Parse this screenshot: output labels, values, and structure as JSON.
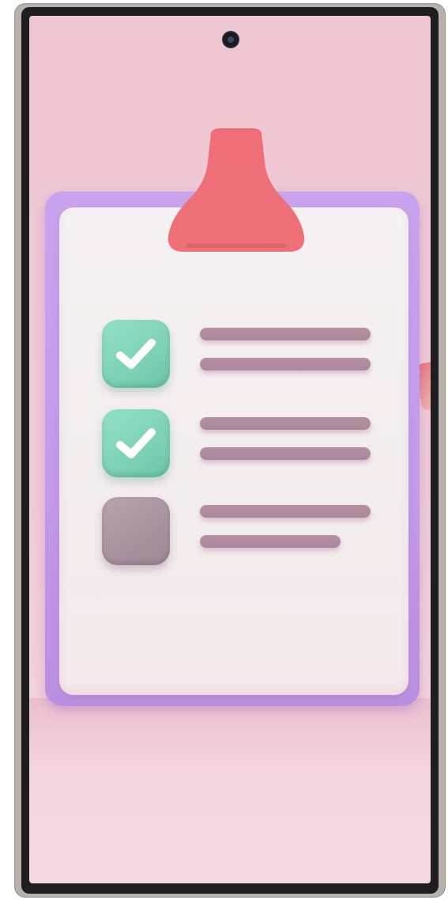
{
  "screen": {
    "type": "phone-wallpaper",
    "background_color": "#efc7d3",
    "description_icon": "clipboard-checklist-illustration"
  },
  "illustration": {
    "board_color": "#c29ae9",
    "paper_color": "#f4eef0",
    "clip_color": "#ef7278",
    "items": [
      {
        "checked": true,
        "checkbox_color": "#7dd1b7",
        "icon": "check-mark-icon"
      },
      {
        "checked": true,
        "checkbox_color": "#7dd1b7",
        "icon": "check-mark-icon"
      },
      {
        "checked": false,
        "checkbox_color": "#a9929f",
        "icon": ""
      }
    ]
  }
}
